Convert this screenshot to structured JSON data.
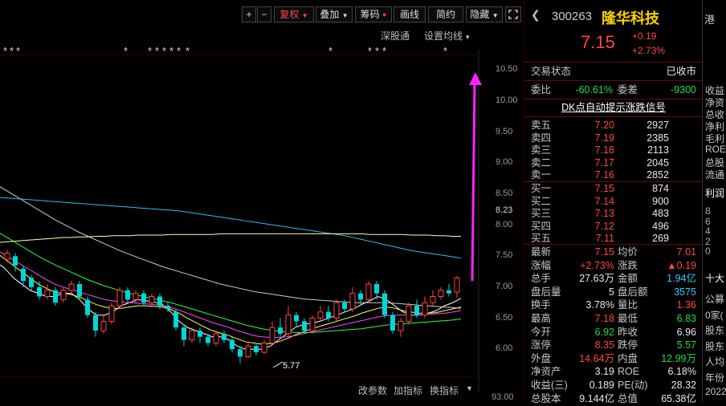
{
  "toolbar": {
    "plus": "+",
    "minus": "−",
    "fuquan": "复权",
    "diejia": "叠加",
    "chouma": "筹码",
    "huaxian": "画线",
    "jianyue": "简约",
    "yincang": "隐藏",
    "fullscreen_icon": "expand-icon"
  },
  "sublinks": {
    "shengutong": "深股通",
    "settings": "设置均线"
  },
  "event_marks": [
    "*",
    "*",
    "*",
    "*",
    "*",
    "*",
    "*",
    "*",
    "*",
    "*",
    "*",
    "*",
    "*",
    "*",
    "*"
  ],
  "y_axis": [
    "10.50",
    "10.00",
    "9.50",
    "9.00",
    "8.50",
    "8.23",
    "8.00",
    "7.50",
    "7.00",
    "6.50",
    "6.00"
  ],
  "bottom_axis": "93.00",
  "low_label": "5.77",
  "bottom_links": {
    "params": "改参数",
    "add": "加指标",
    "switch": "换指标"
  },
  "chart_data": {
    "type": "candlestick",
    "title": "",
    "ylim": [
      5.55,
      10.75
    ],
    "min_price_label": 5.77,
    "candles": [
      {
        "o": 7.45,
        "c": 7.55,
        "h": 7.6,
        "l": 7.4,
        "up": true
      },
      {
        "o": 7.5,
        "c": 7.35,
        "h": 7.55,
        "l": 7.25,
        "up": false
      },
      {
        "o": 7.3,
        "c": 7.1,
        "h": 7.35,
        "l": 7.0,
        "up": false
      },
      {
        "o": 7.15,
        "c": 7.0,
        "h": 7.2,
        "l": 6.95,
        "up": false
      },
      {
        "o": 7.0,
        "c": 6.85,
        "h": 7.1,
        "l": 6.8,
        "up": false
      },
      {
        "o": 6.85,
        "c": 6.95,
        "h": 7.05,
        "l": 6.8,
        "up": true
      },
      {
        "o": 6.95,
        "c": 6.75,
        "h": 7.0,
        "l": 6.7,
        "up": false
      },
      {
        "o": 6.8,
        "c": 6.95,
        "h": 7.0,
        "l": 6.75,
        "up": true
      },
      {
        "o": 6.95,
        "c": 7.05,
        "h": 7.1,
        "l": 6.9,
        "up": true
      },
      {
        "o": 7.05,
        "c": 6.85,
        "h": 7.1,
        "l": 6.8,
        "up": false
      },
      {
        "o": 6.8,
        "c": 6.55,
        "h": 6.85,
        "l": 6.5,
        "up": false
      },
      {
        "o": 6.55,
        "c": 6.3,
        "h": 6.6,
        "l": 6.2,
        "up": false
      },
      {
        "o": 6.3,
        "c": 6.45,
        "h": 6.55,
        "l": 6.25,
        "up": true
      },
      {
        "o": 6.45,
        "c": 6.7,
        "h": 6.75,
        "l": 6.4,
        "up": true
      },
      {
        "o": 6.7,
        "c": 6.95,
        "h": 7.0,
        "l": 6.65,
        "up": true
      },
      {
        "o": 6.95,
        "c": 6.8,
        "h": 7.0,
        "l": 6.75,
        "up": false
      },
      {
        "o": 6.8,
        "c": 6.9,
        "h": 6.95,
        "l": 6.75,
        "up": true
      },
      {
        "o": 6.9,
        "c": 6.75,
        "h": 6.95,
        "l": 6.7,
        "up": false
      },
      {
        "o": 6.75,
        "c": 6.85,
        "h": 6.9,
        "l": 6.7,
        "up": true
      },
      {
        "o": 6.85,
        "c": 6.7,
        "h": 6.9,
        "l": 6.65,
        "up": false
      },
      {
        "o": 6.7,
        "c": 6.65,
        "h": 6.75,
        "l": 6.6,
        "up": false
      },
      {
        "o": 6.6,
        "c": 6.35,
        "h": 6.65,
        "l": 6.3,
        "up": false
      },
      {
        "o": 6.35,
        "c": 6.15,
        "h": 6.4,
        "l": 6.05,
        "up": false
      },
      {
        "o": 6.15,
        "c": 6.3,
        "h": 6.35,
        "l": 6.1,
        "up": true
      },
      {
        "o": 6.3,
        "c": 6.2,
        "h": 6.35,
        "l": 6.1,
        "up": false
      },
      {
        "o": 6.2,
        "c": 6.1,
        "h": 6.25,
        "l": 6.05,
        "up": false
      },
      {
        "o": 6.1,
        "c": 6.25,
        "h": 6.3,
        "l": 6.05,
        "up": true
      },
      {
        "o": 6.25,
        "c": 6.15,
        "h": 6.3,
        "l": 6.1,
        "up": false
      },
      {
        "o": 6.15,
        "c": 6.0,
        "h": 6.2,
        "l": 5.95,
        "up": false
      },
      {
        "o": 6.0,
        "c": 5.88,
        "h": 6.05,
        "l": 5.77,
        "up": false
      },
      {
        "o": 5.88,
        "c": 6.05,
        "h": 6.1,
        "l": 5.85,
        "up": true
      },
      {
        "o": 6.05,
        "c": 5.95,
        "h": 6.1,
        "l": 5.9,
        "up": false
      },
      {
        "o": 5.95,
        "c": 6.1,
        "h": 6.15,
        "l": 5.92,
        "up": true
      },
      {
        "o": 6.1,
        "c": 6.35,
        "h": 6.45,
        "l": 6.08,
        "up": true
      },
      {
        "o": 6.35,
        "c": 6.25,
        "h": 6.5,
        "l": 6.2,
        "up": false
      },
      {
        "o": 6.25,
        "c": 6.55,
        "h": 6.7,
        "l": 6.2,
        "up": true
      },
      {
        "o": 6.55,
        "c": 6.45,
        "h": 6.6,
        "l": 6.35,
        "up": false
      },
      {
        "o": 6.45,
        "c": 6.3,
        "h": 6.5,
        "l": 6.25,
        "up": false
      },
      {
        "o": 6.3,
        "c": 6.5,
        "h": 6.55,
        "l": 6.25,
        "up": true
      },
      {
        "o": 6.5,
        "c": 6.6,
        "h": 6.7,
        "l": 6.45,
        "up": true
      },
      {
        "o": 6.6,
        "c": 6.5,
        "h": 6.7,
        "l": 6.45,
        "up": false
      },
      {
        "o": 6.5,
        "c": 6.75,
        "h": 6.8,
        "l": 6.45,
        "up": true
      },
      {
        "o": 6.75,
        "c": 6.65,
        "h": 6.8,
        "l": 6.6,
        "up": false
      },
      {
        "o": 6.65,
        "c": 6.9,
        "h": 7.0,
        "l": 6.6,
        "up": true
      },
      {
        "o": 6.9,
        "c": 6.8,
        "h": 6.95,
        "l": 6.7,
        "up": false
      },
      {
        "o": 6.8,
        "c": 7.05,
        "h": 7.1,
        "l": 6.75,
        "up": true
      },
      {
        "o": 7.05,
        "c": 6.9,
        "h": 7.1,
        "l": 6.8,
        "up": false
      },
      {
        "o": 6.9,
        "c": 6.55,
        "h": 6.95,
        "l": 6.5,
        "up": false
      },
      {
        "o": 6.55,
        "c": 6.3,
        "h": 6.6,
        "l": 6.25,
        "up": false
      },
      {
        "o": 6.3,
        "c": 6.45,
        "h": 6.5,
        "l": 6.2,
        "up": true
      },
      {
        "o": 6.45,
        "c": 6.7,
        "h": 6.75,
        "l": 6.4,
        "up": true
      },
      {
        "o": 6.7,
        "c": 6.55,
        "h": 6.8,
        "l": 6.5,
        "up": false
      },
      {
        "o": 6.55,
        "c": 6.75,
        "h": 6.85,
        "l": 6.5,
        "up": true
      },
      {
        "o": 6.75,
        "c": 6.85,
        "h": 6.95,
        "l": 6.7,
        "up": true
      },
      {
        "o": 6.85,
        "c": 6.95,
        "h": 7.0,
        "l": 6.8,
        "up": true
      },
      {
        "o": 6.95,
        "c": 6.9,
        "h": 7.05,
        "l": 6.85,
        "up": false
      },
      {
        "o": 6.92,
        "c": 7.15,
        "h": 7.18,
        "l": 6.83,
        "up": true
      }
    ],
    "ma_lines": [
      {
        "color": "#ffffff",
        "points": [
          7.4,
          7.3,
          7.15,
          7.05,
          6.95,
          6.9,
          6.85,
          6.85,
          6.9,
          6.9,
          6.8,
          6.65,
          6.55,
          6.55,
          6.6,
          6.7,
          6.75,
          6.8,
          6.78,
          6.76,
          6.72,
          6.6,
          6.45,
          6.35,
          6.3,
          6.25,
          6.2,
          6.2,
          6.15,
          6.05,
          6.0,
          6.0,
          6.0,
          6.05,
          6.15,
          6.25,
          6.35,
          6.4,
          6.42,
          6.45,
          6.5,
          6.55,
          6.6,
          6.65,
          6.72,
          6.78,
          6.85,
          6.8,
          6.7,
          6.6,
          6.55,
          6.55,
          6.58,
          6.62,
          6.7,
          6.75,
          6.82
        ]
      },
      {
        "color": "#ffff55",
        "points": [
          7.55,
          7.45,
          7.35,
          7.25,
          7.15,
          7.05,
          6.98,
          6.92,
          6.9,
          6.88,
          6.84,
          6.78,
          6.72,
          6.68,
          6.66,
          6.66,
          6.68,
          6.7,
          6.7,
          6.69,
          6.68,
          6.64,
          6.58,
          6.5,
          6.43,
          6.36,
          6.3,
          6.26,
          6.22,
          6.17,
          6.12,
          6.1,
          6.08,
          6.09,
          6.12,
          6.17,
          6.23,
          6.28,
          6.33,
          6.37,
          6.41,
          6.45,
          6.49,
          6.53,
          6.58,
          6.62,
          6.66,
          6.68,
          6.66,
          6.62,
          6.6,
          6.58,
          6.58,
          6.59,
          6.62,
          6.65,
          6.68
        ]
      },
      {
        "color": "#ff44ff",
        "points": [
          7.6,
          7.52,
          7.44,
          7.36,
          7.28,
          7.2,
          7.12,
          7.05,
          7.0,
          6.96,
          6.92,
          6.88,
          6.84,
          6.8,
          6.78,
          6.76,
          6.75,
          6.74,
          6.73,
          6.72,
          6.7,
          6.67,
          6.63,
          6.58,
          6.53,
          6.48,
          6.43,
          6.39,
          6.35,
          6.3,
          6.26,
          6.22,
          6.2,
          6.19,
          6.19,
          6.2,
          6.22,
          6.25,
          6.28,
          6.31,
          6.34,
          6.37,
          6.4,
          6.43,
          6.46,
          6.49,
          6.52,
          6.54,
          6.55,
          6.55,
          6.55,
          6.55,
          6.56,
          6.57,
          6.58,
          6.6,
          6.62
        ]
      },
      {
        "color": "#33ff33",
        "points": [
          7.9,
          7.82,
          7.74,
          7.66,
          7.58,
          7.5,
          7.43,
          7.36,
          7.3,
          7.24,
          7.18,
          7.12,
          7.07,
          7.02,
          6.98,
          6.94,
          6.9,
          6.87,
          6.84,
          6.81,
          6.78,
          6.75,
          6.71,
          6.67,
          6.63,
          6.59,
          6.55,
          6.51,
          6.47,
          6.43,
          6.39,
          6.36,
          6.33,
          6.31,
          6.29,
          6.28,
          6.27,
          6.27,
          6.27,
          6.28,
          6.29,
          6.3,
          6.31,
          6.32,
          6.33,
          6.35,
          6.37,
          6.39,
          6.4,
          6.41,
          6.42,
          6.43,
          6.44,
          6.45,
          6.46,
          6.47,
          6.49
        ]
      },
      {
        "color": "#cccccc",
        "points": [
          8.65,
          8.57,
          8.49,
          8.41,
          8.33,
          8.25,
          8.17,
          8.09,
          8.02,
          7.95,
          7.88,
          7.82,
          7.76,
          7.7,
          7.64,
          7.58,
          7.53,
          7.48,
          7.43,
          7.38,
          7.33,
          7.29,
          7.25,
          7.21,
          7.17,
          7.13,
          7.09,
          7.05,
          7.02,
          6.99,
          6.96,
          6.93,
          6.91,
          6.89,
          6.87,
          6.85,
          6.83,
          6.81,
          6.8,
          6.79,
          6.78,
          6.77,
          6.76,
          6.75,
          6.75,
          6.75,
          6.75,
          6.75,
          6.74,
          6.73,
          6.72,
          6.71,
          6.7,
          6.69,
          6.68,
          6.67,
          6.66
        ]
      },
      {
        "color": "#33bbee",
        "points": [
          8.45,
          8.44,
          8.43,
          8.42,
          8.41,
          8.4,
          8.39,
          8.38,
          8.37,
          8.36,
          8.35,
          8.34,
          8.33,
          8.32,
          8.31,
          8.3,
          8.29,
          8.28,
          8.27,
          8.26,
          8.25,
          8.24,
          8.23,
          8.21,
          8.19,
          8.17,
          8.15,
          8.13,
          8.11,
          8.09,
          8.07,
          8.05,
          8.03,
          8.01,
          7.99,
          7.97,
          7.95,
          7.93,
          7.91,
          7.89,
          7.87,
          7.85,
          7.83,
          7.8,
          7.77,
          7.74,
          7.71,
          7.68,
          7.65,
          7.62,
          7.59,
          7.57,
          7.55,
          7.53,
          7.51,
          7.49,
          7.47
        ]
      },
      {
        "color": "#ffffaa",
        "points": [
          7.72,
          7.73,
          7.74,
          7.75,
          7.76,
          7.77,
          7.78,
          7.79,
          7.8,
          7.8,
          7.81,
          7.81,
          7.82,
          7.82,
          7.83,
          7.83,
          7.83,
          7.84,
          7.84,
          7.84,
          7.84,
          7.85,
          7.85,
          7.85,
          7.85,
          7.85,
          7.85,
          7.86,
          7.86,
          7.86,
          7.86,
          7.86,
          7.86,
          7.86,
          7.86,
          7.86,
          7.86,
          7.86,
          7.86,
          7.86,
          7.86,
          7.86,
          7.86,
          7.86,
          7.86,
          7.85,
          7.85,
          7.85,
          7.85,
          7.85,
          7.84,
          7.84,
          7.84,
          7.83,
          7.83,
          7.82,
          7.82
        ]
      }
    ]
  },
  "quote": {
    "code": "300263",
    "name": "隆华科技",
    "price": "7.15",
    "change": "+0.19",
    "change_pct": "+2.73%",
    "hk_tab": "港"
  },
  "status": {
    "label": "交易状态",
    "value": "已收市"
  },
  "weibi": {
    "label": "委比",
    "value": "-60.61%",
    "label2": "委差",
    "value2": "-9300"
  },
  "signal_link": "DK点自动提示涨跌信号",
  "sell": [
    {
      "label": "卖五",
      "price": "7.20",
      "vol": "2927"
    },
    {
      "label": "卖四",
      "price": "7.19",
      "vol": "2385"
    },
    {
      "label": "卖三",
      "price": "7.18",
      "vol": "2113"
    },
    {
      "label": "卖二",
      "price": "7.17",
      "vol": "2045"
    },
    {
      "label": "卖一",
      "price": "7.16",
      "vol": "2852"
    }
  ],
  "buy": [
    {
      "label": "买一",
      "price": "7.15",
      "vol": "874"
    },
    {
      "label": "买二",
      "price": "7.14",
      "vol": "900"
    },
    {
      "label": "买三",
      "price": "7.13",
      "vol": "483"
    },
    {
      "label": "买四",
      "price": "7.12",
      "vol": "496"
    },
    {
      "label": "买五",
      "price": "7.11",
      "vol": "269"
    }
  ],
  "stats": [
    {
      "l1": "最新",
      "v1": "7.15",
      "c1": "red",
      "l2": "均价",
      "v2": "7.01",
      "c2": "red"
    },
    {
      "l1": "涨幅",
      "v1": "+2.73%",
      "c1": "red",
      "l2": "涨跌",
      "v2": "▲0.19",
      "c2": "red"
    },
    {
      "l1": "总手",
      "v1": "27.63万",
      "c1": "white",
      "l2": "金额",
      "v2": "1.94亿",
      "c2": "cyan"
    },
    {
      "l1": "盘后量",
      "v1": "5",
      "c1": "white",
      "l2": "盘后额",
      "v2": "3575",
      "c2": "cyan"
    },
    {
      "l1": "换手",
      "v1": "3.78%",
      "c1": "white",
      "l2": "量比",
      "v2": "1.36",
      "c2": "red"
    },
    {
      "l1": "最高",
      "v1": "7.18",
      "c1": "red",
      "l2": "最低",
      "v2": "6.83",
      "c2": "green"
    },
    {
      "l1": "今开",
      "v1": "6.92",
      "c1": "green",
      "l2": "昨收",
      "v2": "6.96",
      "c2": "white"
    },
    {
      "l1": "涨停",
      "v1": "8.35",
      "c1": "red",
      "l2": "跌停",
      "v2": "5.57",
      "c2": "green"
    },
    {
      "l1": "外盘",
      "v1": "14.64万",
      "c1": "red",
      "l2": "内盘",
      "v2": "12.99万",
      "c2": "green"
    },
    {
      "l1": "净资产",
      "v1": "3.19",
      "c1": "white",
      "l2": "ROE",
      "v2": "6.18%",
      "c2": "white"
    },
    {
      "l1": "收益(三)",
      "v1": "0.189",
      "c1": "white",
      "l2": "PE(动)",
      "v2": "28.32",
      "c2": "white"
    },
    {
      "l1": "总股本",
      "v1": "9.144亿",
      "c1": "white",
      "l2": "总值",
      "v2": "65.38亿",
      "c2": "white"
    }
  ],
  "side_panel": {
    "top": "港",
    "items": [
      "收益",
      "净资",
      "总收",
      "净利",
      "毛利",
      "ROE",
      "总股",
      "流通"
    ],
    "section1": "利润",
    "digits": [
      "8",
      "6",
      "4",
      "2",
      "0"
    ],
    "section2": "十大",
    "items2": [
      "公募",
      "0家(",
      "股东",
      "股东",
      "人均",
      "年份",
      "2022"
    ]
  },
  "colors": {
    "up": "#ff4545",
    "down": "#00d7d7",
    "arrow": "#ff22ff",
    "brand_name": "#ffd200"
  }
}
